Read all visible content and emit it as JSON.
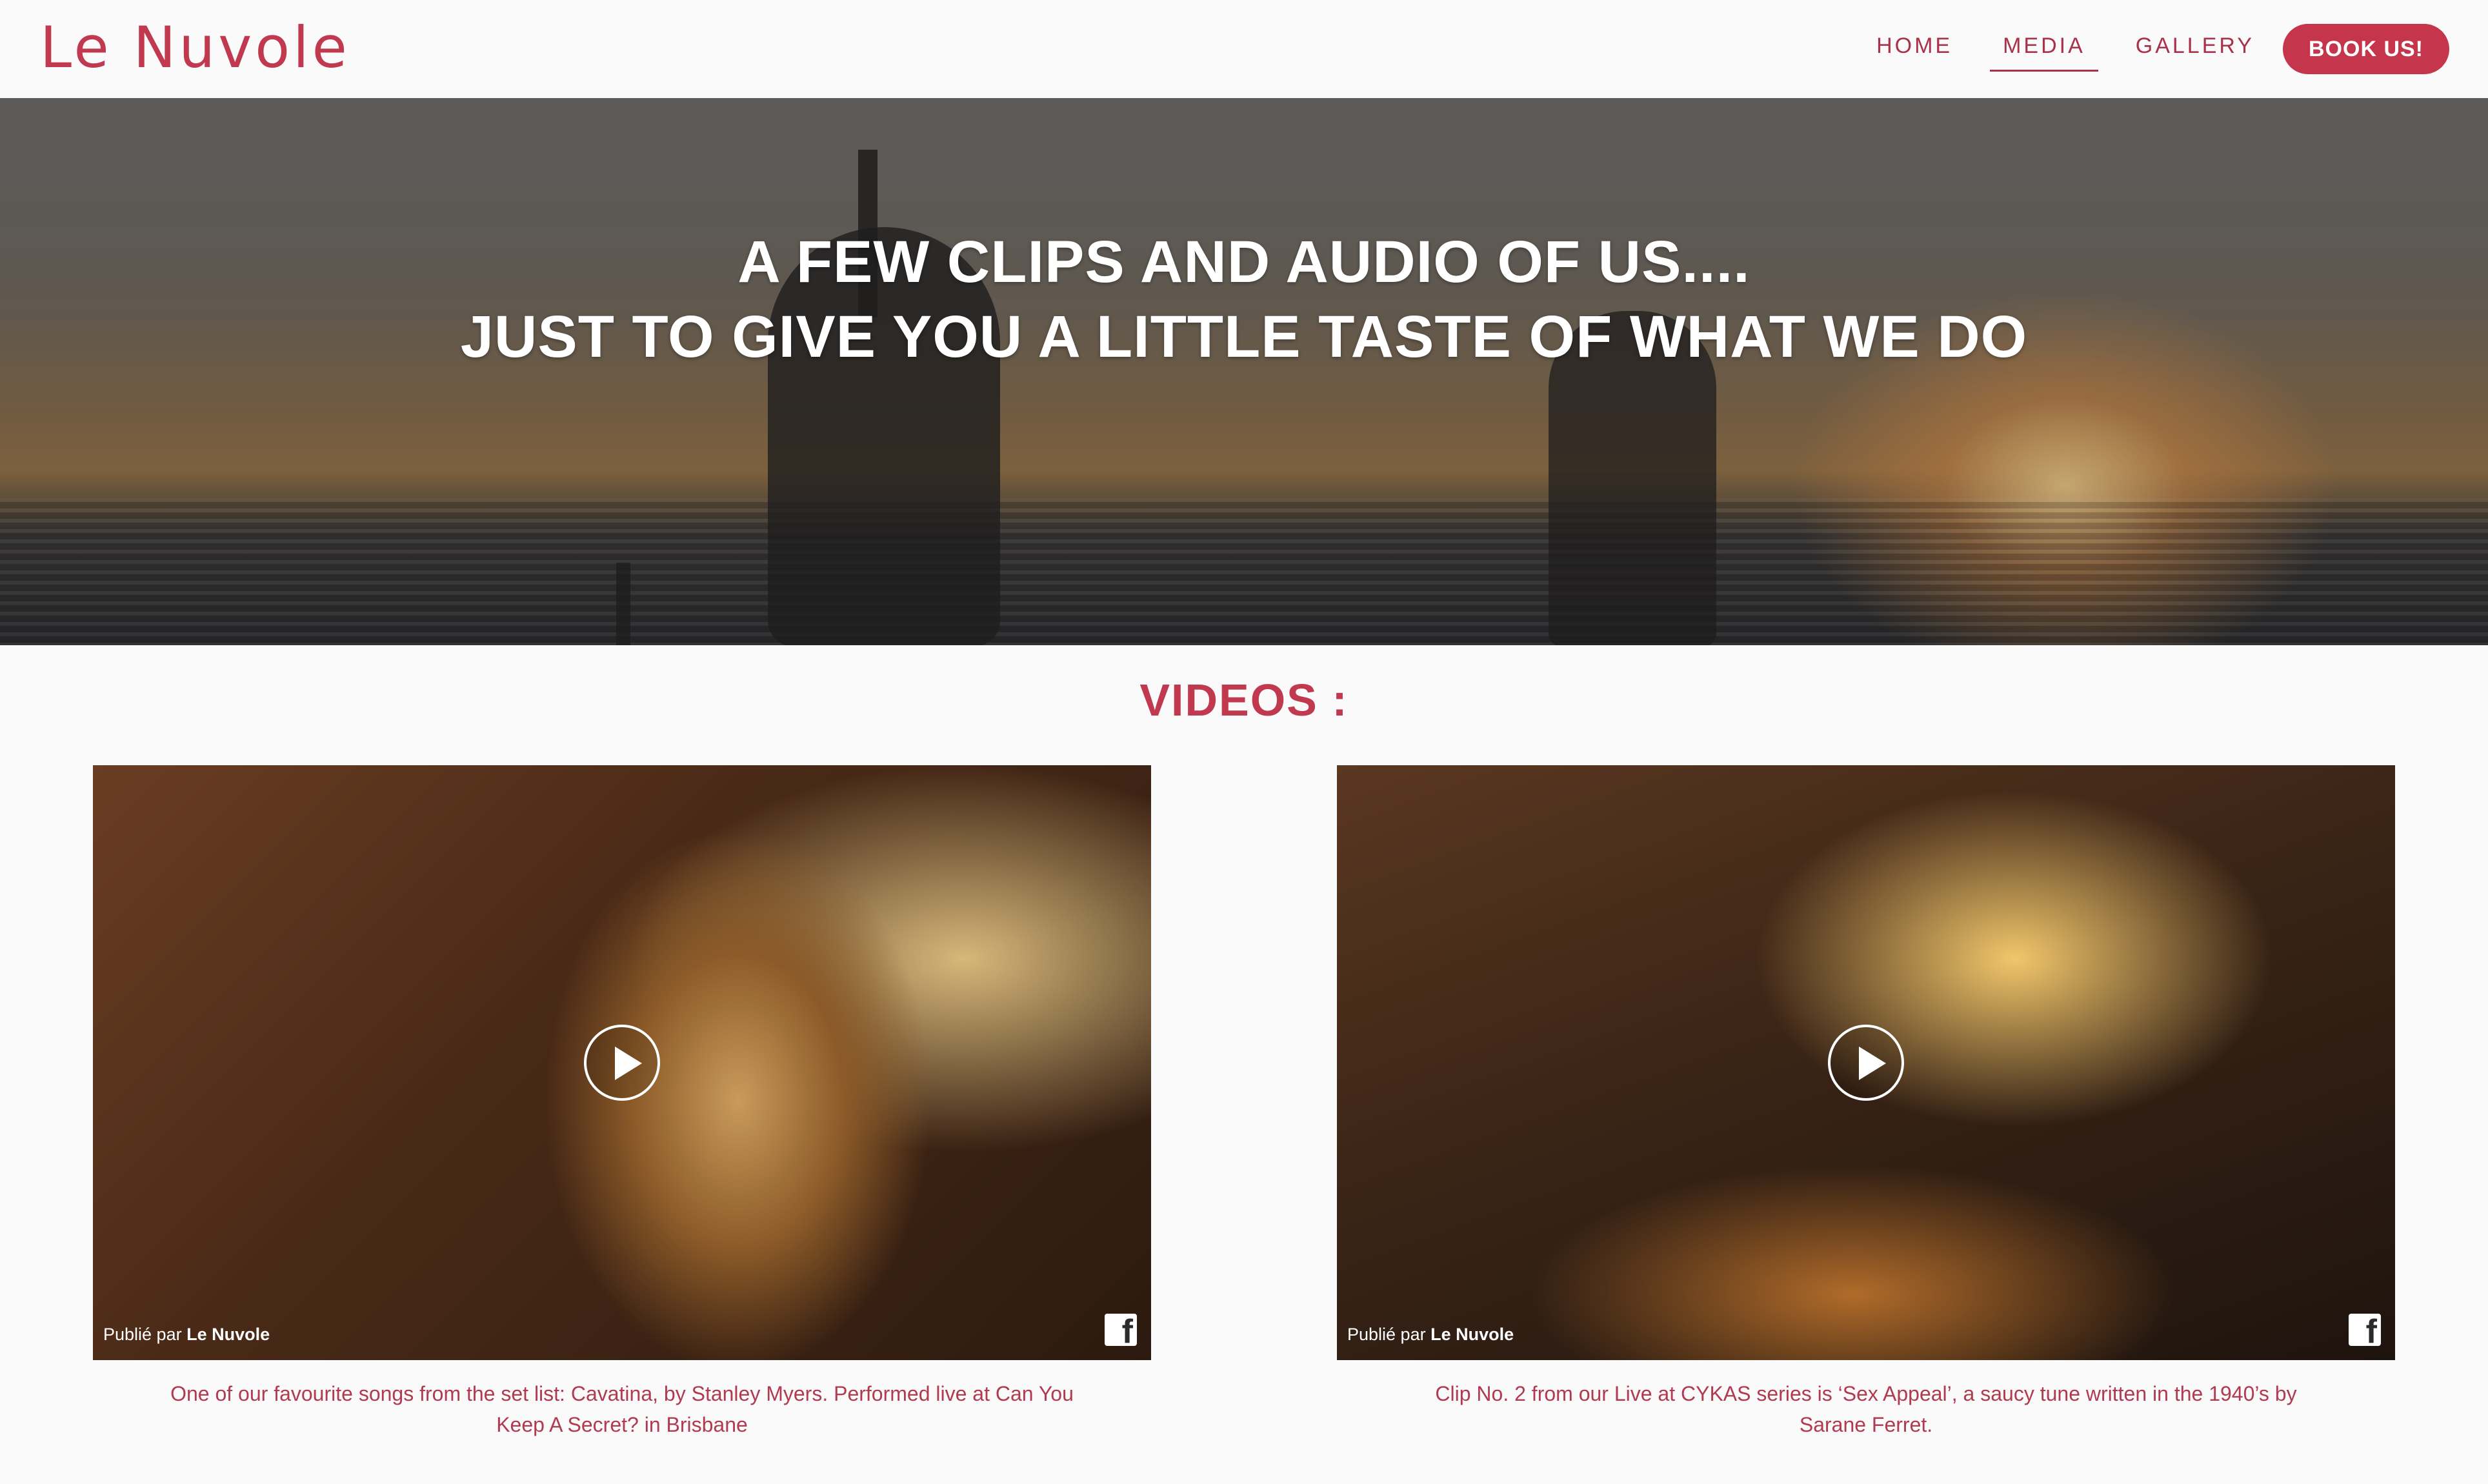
{
  "header": {
    "logo": "Le Nuvole",
    "nav": [
      {
        "label": "HOME",
        "active": false
      },
      {
        "label": "MEDIA",
        "active": true
      },
      {
        "label": "GALLERY",
        "active": false
      }
    ],
    "cta_label": "BOOK US!",
    "accent_color": "#c5354c"
  },
  "hero": {
    "line1": "A FEW CLIPS AND AUDIO OF US....",
    "line2": "JUST TO GIVE YOU A LITTLE TASTE OF WHAT WE DO"
  },
  "videos_section": {
    "title": "VIDEOS :",
    "videos": [
      {
        "publisher_prefix": "Publié par",
        "publisher_name": "Le Nuvole",
        "caption": "One of our favourite songs from the set list: Cavatina, by Stanley Myers. Performed live at Can You Keep A Secret? in Brisbane",
        "play_icon": "play-icon",
        "social_icon": "facebook-icon"
      },
      {
        "publisher_prefix": "Publié par",
        "publisher_name": "Le Nuvole",
        "caption": "Clip No. 2 from our Live at CYKAS series is ‘Sex Appeal’, a saucy tune written in the 1940’s by Sarane Ferret.",
        "play_icon": "play-icon",
        "social_icon": "facebook-icon"
      }
    ]
  }
}
